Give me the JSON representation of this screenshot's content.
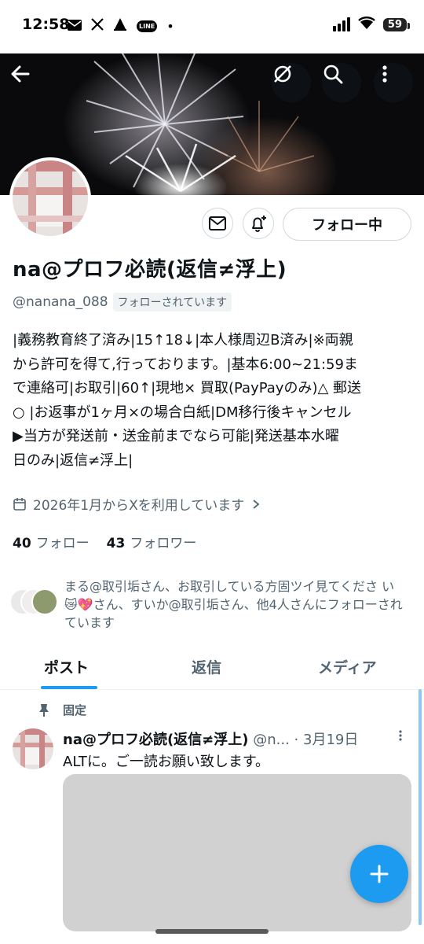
{
  "status_bar": {
    "time": "12:58",
    "notif_icons": [
      "mail-icon",
      "x-icon",
      "camp-icon",
      "line-icon",
      "dot-icon"
    ],
    "line_label": "LINE",
    "battery": "59"
  },
  "header": {
    "back_icon": "back-arrow-icon",
    "buttons": [
      "no-translate-icon",
      "search-icon",
      "more-vertical-icon"
    ]
  },
  "profile": {
    "name": "na@プロフ必読(返信≠浮上)",
    "handle": "@nanana_088",
    "follows_you": "フォローされています",
    "bio": "|義務教育終了済み|15↑18↓|本人様周辺B済み|※両親\nから許可を得て,行っております。|基本6:00~21:59ま\nで連絡可|お取引|60↑|現地× 買取(PayPayのみ)△ 郵送\n○ |お返事が1ヶ月×の場合白紙|DM移行後キャンセル\n▶当方が発送前・送金前までなら可能|発送基本水曜\n日のみ|返信≠浮上|",
    "joined": "2026年1月からXを利用しています",
    "following_count": "40",
    "following_label": "フォロー",
    "followers_count": "43",
    "followers_label": "フォロワー",
    "follow_button": "フォロー中",
    "mutuals_text": "まる@取引垢さん、お取引している方固ツイ見てくださ い 😿💖さん、すいか@取引垢さん、他4人さんにフォローされています"
  },
  "tabs": [
    {
      "label": "ポスト",
      "active": true
    },
    {
      "label": "返信",
      "active": false
    },
    {
      "label": "メディア",
      "active": false
    }
  ],
  "pinned_tweet": {
    "pinned_label": "固定",
    "name": "na@プロフ必読(返信≠浮上)",
    "handle": "@n...",
    "date": "· 3月19日",
    "text": "ALTに。ご一読お願い致します。"
  },
  "colors": {
    "accent": "#1d9bf0",
    "secondary_text": "#536471",
    "border": "#cfd9de"
  }
}
